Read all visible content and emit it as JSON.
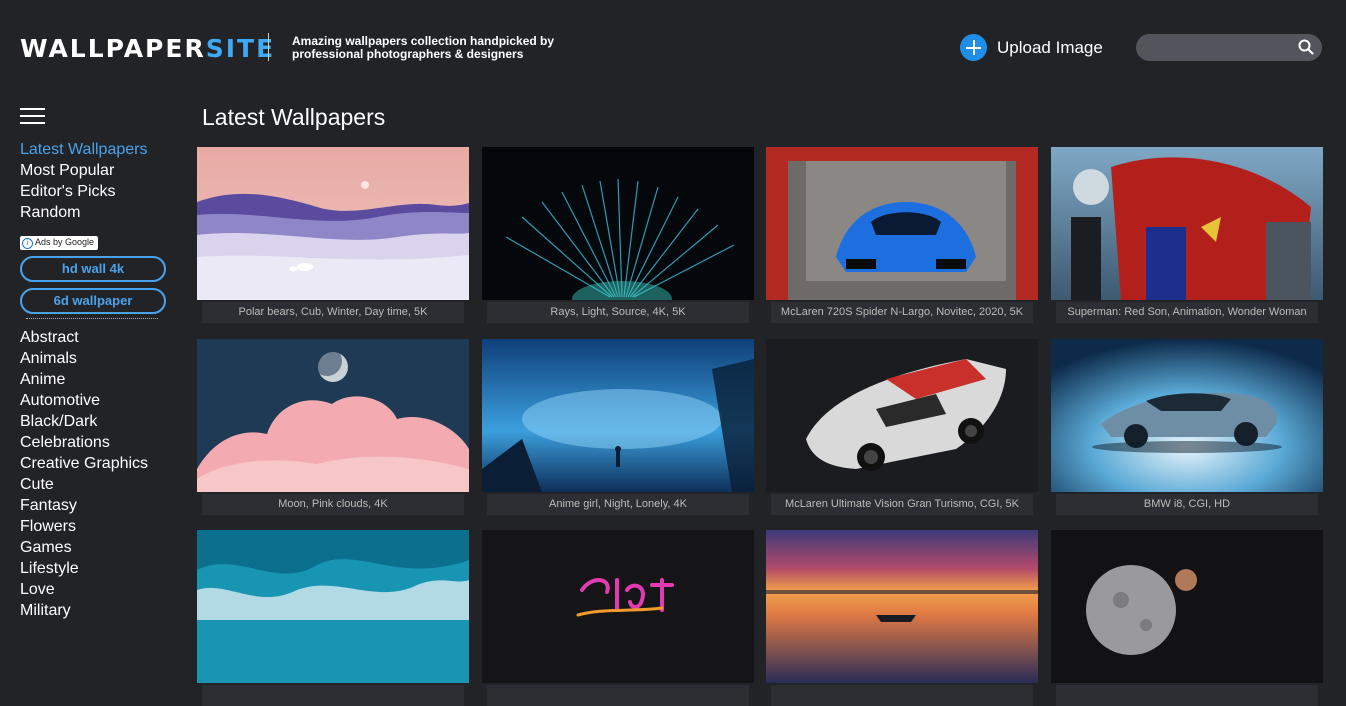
{
  "header": {
    "logo_main": "WALLPAPER",
    "logo_accent": "SITE",
    "tagline": "Amazing wallpapers collection handpicked by professional photographers & designers",
    "upload_label": "Upload Image",
    "search_placeholder": "",
    "accent_color": "#3fa9f5"
  },
  "sidebar": {
    "menu_icon": "hamburger-icon",
    "nav": [
      "Latest Wallpapers",
      "Most Popular",
      "Editor's Picks",
      "Random"
    ],
    "active_nav": "Latest Wallpapers",
    "ads_label": "Ads by Google",
    "ad_links": [
      "hd wall 4k",
      "6d wallpaper"
    ],
    "categories": [
      "Abstract",
      "Animals",
      "Anime",
      "Automotive",
      "Black/Dark",
      "Celebrations",
      "Creative Graphics",
      "Cute",
      "Fantasy",
      "Flowers",
      "Games",
      "Lifestyle",
      "Love",
      "Military"
    ]
  },
  "main": {
    "title": "Latest Wallpapers",
    "wallpapers": [
      {
        "caption": "Polar bears, Cub, Winter, Day time, 5K"
      },
      {
        "caption": "Rays, Light, Source, 4K, 5K"
      },
      {
        "caption": "McLaren 720S Spider N-Largo, Novitec, 2020, 5K"
      },
      {
        "caption": "Superman: Red Son, Animation, Wonder Woman"
      },
      {
        "caption": "Moon, Pink clouds, 4K"
      },
      {
        "caption": "Anime girl, Night, Lonely, 4K"
      },
      {
        "caption": "McLaren Ultimate Vision Gran Turismo, CGI, 5K"
      },
      {
        "caption": "BMW i8, CGI, HD"
      },
      {
        "caption": ""
      },
      {
        "caption": ""
      },
      {
        "caption": ""
      },
      {
        "caption": ""
      }
    ]
  }
}
